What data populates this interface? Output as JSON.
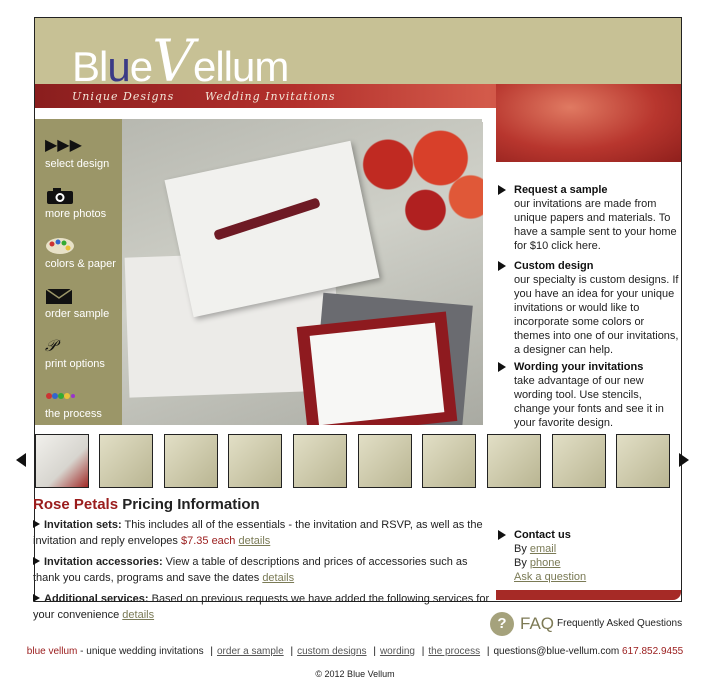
{
  "header": {
    "logo_blue": "Bl",
    "logo_u": "u",
    "logo_e": "e",
    "logo_v": "V",
    "logo_ellum": "ellum",
    "tagline_left": "Unique Designs",
    "tagline_right": "Wedding Invitations"
  },
  "sidebar": {
    "items": [
      {
        "label": "select design",
        "icon": "play-arrows-icon"
      },
      {
        "label": "more photos",
        "icon": "camera-icon"
      },
      {
        "label": "colors & paper",
        "icon": "palette-icon"
      },
      {
        "label": "order sample",
        "icon": "envelope-icon"
      },
      {
        "label": "print options",
        "icon": "print-icon"
      },
      {
        "label": "the process",
        "icon": "process-icon"
      }
    ]
  },
  "right_panel": {
    "request": {
      "heading": "Request a sample",
      "body": "our invitations are made from unique papers and materials. To have a sample sent to your home for $10 click here."
    },
    "custom": {
      "heading": "Custom design",
      "body": "our specialty is custom designs. If you have an idea for your unique invitations or would like to incorporate some colors or themes into one of our invitations, a designer can help."
    },
    "wording": {
      "heading": "Wording your invitations",
      "body": "take advantage of our new wording tool. Use stencils, change your fonts and see it in your favorite design."
    },
    "contact": {
      "heading": "Contact us",
      "by1": "By ",
      "email": "email",
      "by2": "By ",
      "phone": "phone",
      "ask": "Ask a question"
    }
  },
  "pricing": {
    "title_red": "Rose Petals",
    "title_rest": " Pricing Information",
    "sets_label": "Invitation sets:",
    "sets_text": " This includes all of the essentials - the invitation and RSVP, as well as the invitation and reply envelopes ",
    "sets_price": "$7.35 each",
    "sets_link": "details",
    "acc_label": "Invitation accessories:",
    "acc_text": " View a table of descriptions and prices of accessories such as thank you cards, programs and save the dates ",
    "acc_link": "details",
    "add_label": "Additional services:",
    "add_text": " Based on previous requests we have added the following services for your convenience ",
    "add_link": "details"
  },
  "faq": {
    "glyph": "?",
    "word": "FAQ",
    "desc": "Frequently Asked Questions"
  },
  "footer": {
    "brand": "blue vellum",
    "brand_rest": " - unique wedding invitations",
    "links": [
      "order a sample",
      "custom designs",
      "wording",
      "the process"
    ],
    "email": "questions@blue-vellum.com",
    "phone": "617.852.9455",
    "copyright": "© 2012 Blue Vellum"
  },
  "colors": {
    "accent_red": "#9a1c1c",
    "olive": "#9b9668",
    "khaki": "#c7c195"
  }
}
